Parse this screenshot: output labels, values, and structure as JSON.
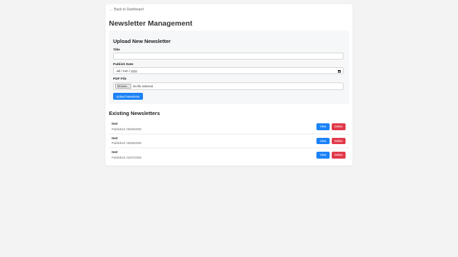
{
  "nav": {
    "back_label": "← Back to Dashboard"
  },
  "page": {
    "title": "Newsletter Management"
  },
  "upload": {
    "heading": "Upload New Newsletter",
    "title_label": "Title",
    "title_value": "",
    "date_label": "Publish Date",
    "date_placeholder": "dd / mm / yyyy",
    "file_label": "PDF File",
    "browse_label": "Browse...",
    "file_status": "No file selected.",
    "submit_label": "Upload Newsletter"
  },
  "existing": {
    "heading": "Existing Newsletters",
    "items": [
      {
        "title": "test",
        "published": "Published: 05/06/2025",
        "view_label": "View",
        "delete_label": "Delete"
      },
      {
        "title": "test",
        "published": "Published: 05/06/2025",
        "view_label": "View",
        "delete_label": "Delete"
      },
      {
        "title": "test",
        "published": "Published: 01/07/2025",
        "view_label": "View",
        "delete_label": "Delete"
      }
    ]
  },
  "colors": {
    "primary": "#1a82f7",
    "danger": "#e0394a",
    "background": "#f3f3f3"
  }
}
